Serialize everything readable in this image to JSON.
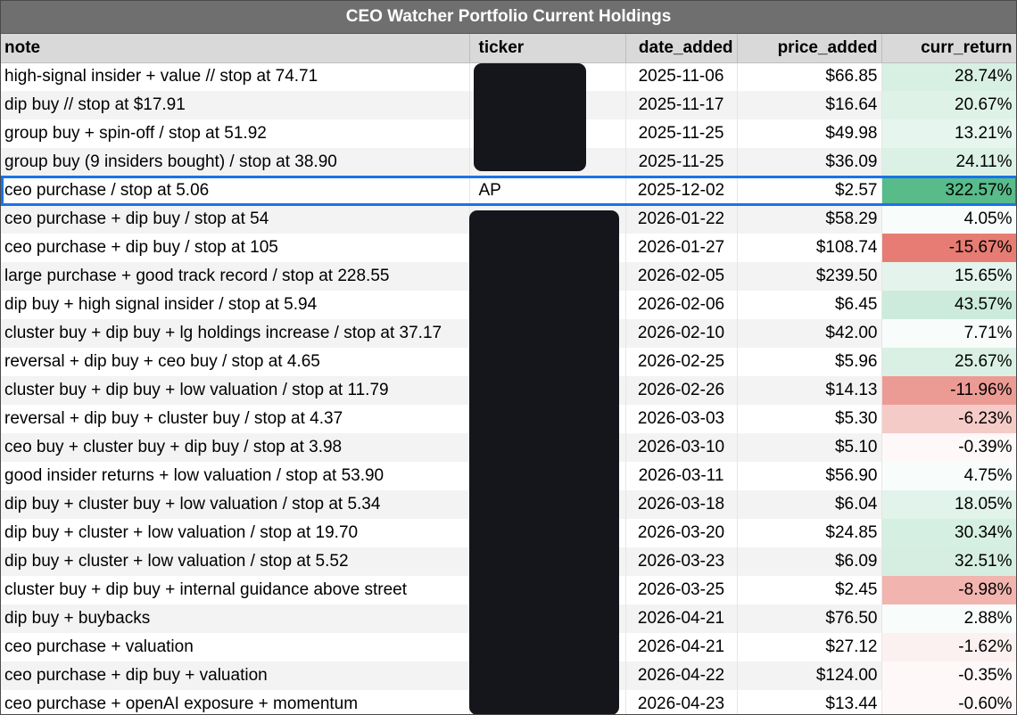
{
  "title": "CEO Watcher Portfolio Current Holdings",
  "columns": {
    "note": "note",
    "ticker": "ticker",
    "date_added": "date_added",
    "price_added": "price_added",
    "curr_return": "curr_return"
  },
  "rows": [
    {
      "note": "high-signal insider + value // stop at 74.71",
      "ticker": "",
      "date_added": "2025-11-06",
      "price_added": "$66.85",
      "curr_return": "28.74%"
    },
    {
      "note": "dip buy // stop at $17.91",
      "ticker": "",
      "date_added": "2025-11-17",
      "price_added": "$16.64",
      "curr_return": "20.67%"
    },
    {
      "note": "group buy + spin-off / stop at 51.92",
      "ticker": "",
      "date_added": "2025-11-25",
      "price_added": "$49.98",
      "curr_return": "13.21%"
    },
    {
      "note": "group buy (9 insiders bought) / stop at 38.90",
      "ticker": "",
      "date_added": "2025-11-25",
      "price_added": "$36.09",
      "curr_return": "24.11%"
    },
    {
      "note": "ceo purchase / stop at 5.06",
      "ticker": "AP",
      "date_added": "2025-12-02",
      "price_added": "$2.57",
      "curr_return": "322.57%"
    },
    {
      "note": "ceo purchase + dip buy / stop at 54",
      "ticker": "",
      "date_added": "2026-01-22",
      "price_added": "$58.29",
      "curr_return": "4.05%"
    },
    {
      "note": "ceo purchase + dip buy / stop at 105",
      "ticker": "",
      "date_added": "2026-01-27",
      "price_added": "$108.74",
      "curr_return": "-15.67%"
    },
    {
      "note": "large purchase + good track record / stop at 228.55",
      "ticker": "",
      "date_added": "2026-02-05",
      "price_added": "$239.50",
      "curr_return": "15.65%"
    },
    {
      "note": "dip buy + high signal insider / stop at 5.94",
      "ticker": "",
      "date_added": "2026-02-06",
      "price_added": "$6.45",
      "curr_return": "43.57%"
    },
    {
      "note": "cluster buy + dip buy + lg holdings increase / stop at 37.17",
      "ticker": "",
      "date_added": "2026-02-10",
      "price_added": "$42.00",
      "curr_return": "7.71%"
    },
    {
      "note": "reversal + dip buy + ceo buy / stop at 4.65",
      "ticker": "",
      "date_added": "2026-02-25",
      "price_added": "$5.96",
      "curr_return": "25.67%"
    },
    {
      "note": "cluster buy + dip buy + low valuation / stop at 11.79",
      "ticker": "",
      "date_added": "2026-02-26",
      "price_added": "$14.13",
      "curr_return": "-11.96%"
    },
    {
      "note": "reversal + dip buy + cluster buy / stop at 4.37",
      "ticker": "",
      "date_added": "2026-03-03",
      "price_added": "$5.30",
      "curr_return": "-6.23%"
    },
    {
      "note": "ceo buy + cluster buy + dip buy / stop at 3.98",
      "ticker": "",
      "date_added": "2026-03-10",
      "price_added": "$5.10",
      "curr_return": "-0.39%"
    },
    {
      "note": "good insider returns + low valuation / stop at 53.90",
      "ticker": "",
      "date_added": "2026-03-11",
      "price_added": "$56.90",
      "curr_return": "4.75%"
    },
    {
      "note": "dip buy + cluster buy + low valuation / stop at 5.34",
      "ticker": "",
      "date_added": "2026-03-18",
      "price_added": "$6.04",
      "curr_return": "18.05%"
    },
    {
      "note": "dip buy + cluster + low valuation / stop at 19.70",
      "ticker": "",
      "date_added": "2026-03-20",
      "price_added": "$24.85",
      "curr_return": "30.34%"
    },
    {
      "note": "dip buy + cluster + low valuation / stop at 5.52",
      "ticker": "",
      "date_added": "2026-03-23",
      "price_added": "$6.09",
      "curr_return": "32.51%"
    },
    {
      "note": "cluster buy + dip buy + internal guidance above street",
      "ticker": "",
      "date_added": "2026-03-25",
      "price_added": "$2.45",
      "curr_return": "-8.98%"
    },
    {
      "note": "dip buy + buybacks",
      "ticker": "",
      "date_added": "2026-04-21",
      "price_added": "$76.50",
      "curr_return": "2.88%"
    },
    {
      "note": "ceo purchase + valuation",
      "ticker": "",
      "date_added": "2026-04-21",
      "price_added": "$27.12",
      "curr_return": "-1.62%"
    },
    {
      "note": "ceo purchase + dip buy + valuation",
      "ticker": "",
      "date_added": "2026-04-22",
      "price_added": "$124.00",
      "curr_return": "-0.35%"
    },
    {
      "note": "ceo purchase + openAI exposure + momentum",
      "ticker": "",
      "date_added": "2026-04-23",
      "price_added": "$13.44",
      "curr_return": "-0.60%"
    }
  ],
  "selected_row": 4,
  "colors": {
    "positive": "#57bb8a",
    "negative": "#e67c73",
    "selection": "#1a73e8",
    "redaction": "#15161b"
  }
}
